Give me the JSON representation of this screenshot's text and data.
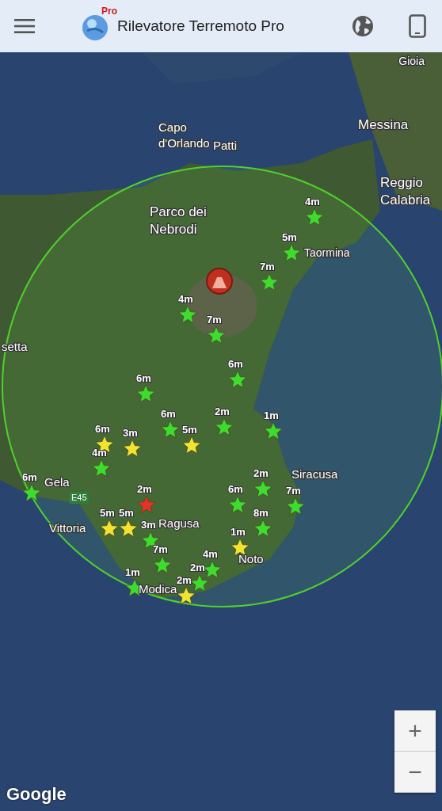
{
  "app_bar": {
    "title": "Rilevatore Terremoto Pro",
    "logo_badge": "Pro"
  },
  "map": {
    "places": [
      {
        "name": "Gioia"
      },
      {
        "name": "Capo\nd'Orlando"
      },
      {
        "name": "Patti"
      },
      {
        "name": "Messina"
      },
      {
        "name": "Reggio\nCalabria"
      },
      {
        "name": "Parco dei\nNebrodi"
      },
      {
        "name": "Taormina"
      },
      {
        "name": "setta"
      },
      {
        "name": "Gela"
      },
      {
        "name": "Vittoria"
      },
      {
        "name": "Ragusa"
      },
      {
        "name": "Modica"
      },
      {
        "name": "Noto"
      },
      {
        "name": "Siracusa"
      },
      {
        "name": "E45"
      }
    ],
    "markers": [
      {
        "label": "4m",
        "color": "#3ddc2f"
      },
      {
        "label": "5m",
        "color": "#3ddc2f"
      },
      {
        "label": "4m",
        "color": "#3ddc2f"
      },
      {
        "label": "7m",
        "color": "#3ddc2f"
      },
      {
        "label": "6m",
        "color": "#3ddc2f"
      },
      {
        "label": "6m",
        "color": "#3ddc2f"
      },
      {
        "label": "5m",
        "color": "#f2e332"
      },
      {
        "label": "2m",
        "color": "#3ddc2f"
      },
      {
        "label": "3m",
        "color": "#f2e332"
      },
      {
        "label": "6m",
        "color": "#f2e332"
      },
      {
        "label": "4m",
        "color": "#3ddc2f"
      },
      {
        "label": "6m",
        "color": "#3ddc2f"
      },
      {
        "label": "2m",
        "color": "#e53224"
      },
      {
        "label": "5m",
        "color": "#f2e332"
      },
      {
        "label": "5m",
        "color": "#f2e332"
      },
      {
        "label": "3m",
        "color": "#3ddc2f"
      },
      {
        "label": "7m",
        "color": "#3ddc2f"
      },
      {
        "label": "1m",
        "color": "#3ddc2f"
      },
      {
        "label": "2m",
        "color": "#f2e332"
      },
      {
        "label": "4m",
        "color": "#3ddc2f"
      },
      {
        "label": "2m",
        "color": "#3ddc2f"
      },
      {
        "label": "6m",
        "color": "#3ddc2f"
      },
      {
        "label": "1m",
        "color": "#f2e332"
      },
      {
        "label": "8m",
        "color": "#3ddc2f"
      },
      {
        "label": "7m",
        "color": "#3ddc2f"
      },
      {
        "label": "1m",
        "color": "#3ddc2f"
      },
      {
        "label": "6m",
        "color": "#3ddc2f"
      },
      {
        "label": "2m",
        "color": "#3ddc2f"
      },
      {
        "label": "7m",
        "color": "#3ddc2f"
      }
    ],
    "zoom_in": "+",
    "zoom_out": "−",
    "attribution": "Google"
  }
}
